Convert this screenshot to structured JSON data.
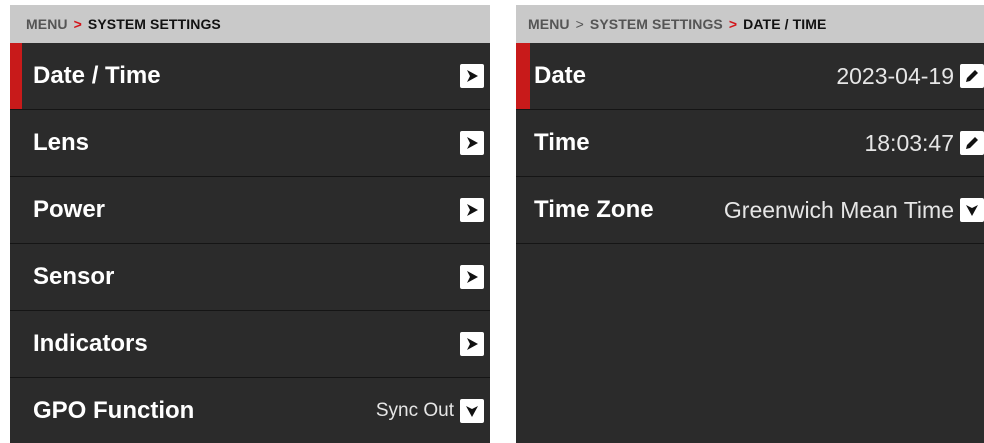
{
  "left": {
    "breadcrumb": {
      "root": "MENU",
      "separator": ">",
      "current": "SYSTEM SETTINGS"
    },
    "items": [
      {
        "label": "Date / Time",
        "selected": true,
        "control": "chevron-right-icon"
      },
      {
        "label": "Lens",
        "control": "chevron-right-icon"
      },
      {
        "label": "Power",
        "control": "chevron-right-icon"
      },
      {
        "label": "Sensor",
        "control": "chevron-right-icon"
      },
      {
        "label": "Indicators",
        "control": "chevron-right-icon"
      },
      {
        "label": "GPO Function",
        "value": "Sync Out",
        "control": "chevron-down-icon"
      }
    ]
  },
  "right": {
    "breadcrumb": {
      "root": "MENU",
      "separator1": ">",
      "middle": "SYSTEM SETTINGS",
      "separator2": ">",
      "current": "DATE / TIME"
    },
    "items": [
      {
        "label": "Date",
        "value": "2023-04-19",
        "selected": true,
        "control": "edit-pencil-icon"
      },
      {
        "label": "Time",
        "value": "18:03:47",
        "control": "edit-pencil-icon"
      },
      {
        "label": "Time Zone",
        "value": "Greenwich Mean Time",
        "control": "chevron-down-icon"
      }
    ]
  },
  "colors": {
    "accent": "#c81a1a",
    "panel": "#2b2b2b",
    "header": "#c9c9c9",
    "separator_red": "#d3141a"
  }
}
